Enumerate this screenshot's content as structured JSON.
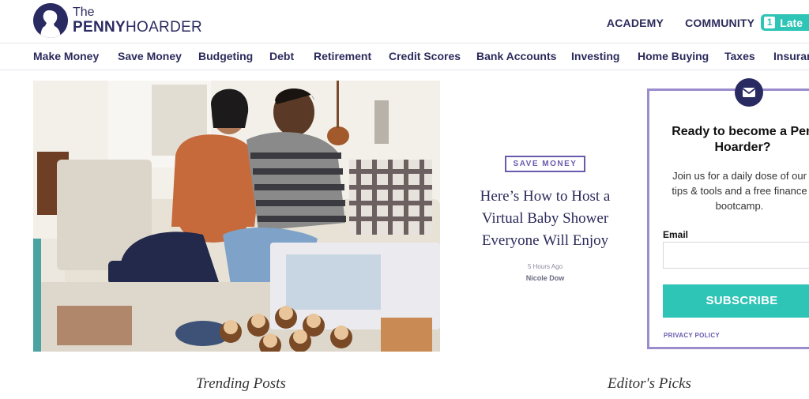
{
  "logo": {
    "the": "The",
    "penny": "PENNY",
    "hoarder": "HOARDER"
  },
  "top_links": {
    "academy": "ACADEMY",
    "community": "COMMUNITY",
    "latest_count": "1",
    "latest_label": "Late"
  },
  "nav": {
    "items": [
      "Make Money",
      "Save Money",
      "Budgeting",
      "Debt",
      "Retirement",
      "Credit Scores",
      "Bank Accounts",
      "Investing",
      "Home Buying",
      "Taxes",
      "Insuran"
    ]
  },
  "featured": {
    "category": "SAVE MONEY",
    "title_lines": [
      "Here’s How to Host a",
      "Virtual Baby Shower",
      "Everyone Will Enjoy"
    ],
    "time": "5 Hours Ago",
    "author": "Nicole Dow"
  },
  "signup": {
    "title_lines": [
      "Ready to become a Pen",
      "Hoarder?"
    ],
    "desc_lines": [
      "Join us for a daily dose of our",
      "tips & tools and a free finance",
      "bootcamp."
    ],
    "email_label": "Email",
    "email_value": "",
    "email_placeholder": "",
    "subscribe_label": "SUBSCRIBE",
    "privacy_label": "PRIVACY POLICY"
  },
  "sections": {
    "trending": "Trending Posts",
    "editors": "Editor's Picks"
  },
  "colors": {
    "brand_navy": "#2a2a62",
    "teal": "#2ec4b6",
    "purple": "#6a5aad"
  },
  "icons": {
    "logo": "penny-hoarder-silhouette-icon",
    "mail": "envelope-icon"
  }
}
